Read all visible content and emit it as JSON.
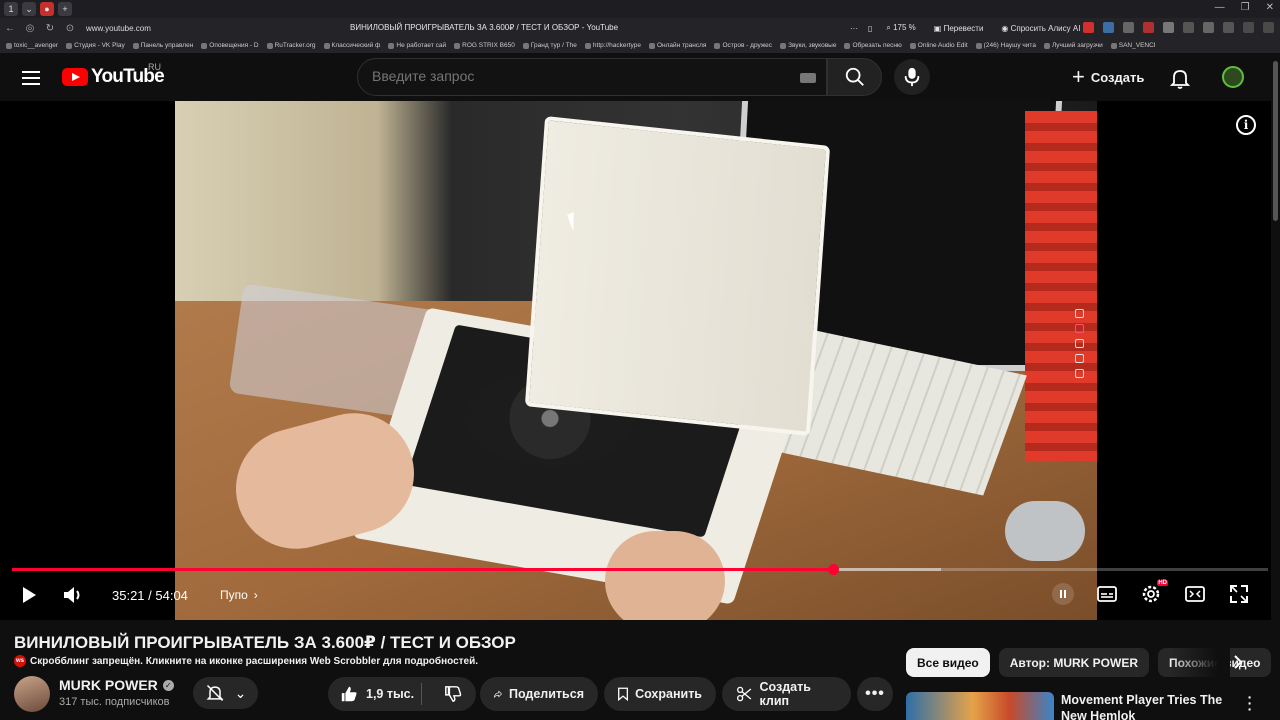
{
  "browser": {
    "url": "www.youtube.com",
    "tab_title": "ВИНИЛОВЫЙ ПРОИГРЫВАТЕЛЬ ЗА 3.600₽ / ТЕСТ И ОБЗОР - YouTube",
    "zoom": "175 %",
    "translate": "Перевести",
    "ask_alice": "Спросить Алису AI",
    "bookmarks": [
      "toxic__avenger",
      "Студия - VK Play",
      "Панель управлен",
      "Оповещения - D",
      "RuTracker.org",
      "Классический ф",
      "Не работает сай",
      "ROG STRIX B650",
      "Гранд тур / The",
      "http://hackertype",
      "Онлайн трансля",
      "Остров - дружес",
      "Звуки, звуковые",
      "Обрезать песню",
      "Online Audio Edit",
      "(246) Наушу чита",
      "Лучший загрузчи",
      "SAN_VENCI"
    ]
  },
  "header": {
    "logo_text": "YouTube",
    "region": "RU",
    "search_placeholder": "Введите запрос",
    "create_label": "Создать"
  },
  "player": {
    "time_current": "35:21",
    "time_total": "54:04",
    "time_display": "35:21 / 54:04",
    "progress_fraction": 0.6538,
    "buffered_fraction": 0.74,
    "chapter": "Пупо"
  },
  "video": {
    "title": "ВИНИЛОВЫЙ ПРОИГРЫВАТЕЛЬ ЗА 3.600₽ / ТЕСТ И ОБЗОР",
    "scrobble_notice": "Скробблинг запрещён. Кликните на иконке расширения Web Scrobbler для подробностей.",
    "scrobble_icon_text": "ws"
  },
  "channel": {
    "name": "MURK POWER",
    "subscribers": "317 тыс. подписчиков"
  },
  "actions": {
    "likes": "1,9 тыс.",
    "share": "Поделиться",
    "save": "Сохранить",
    "clip": "Создать клип"
  },
  "chips": [
    "Все видео",
    "Автор: MURK POWER",
    "Похожие видео"
  ],
  "recommendation": {
    "title": "Movement Player Tries The New Hemlok"
  },
  "colors": {
    "accent_red": "#ff0033",
    "background": "#0f0f0f",
    "pill": "#272727"
  }
}
